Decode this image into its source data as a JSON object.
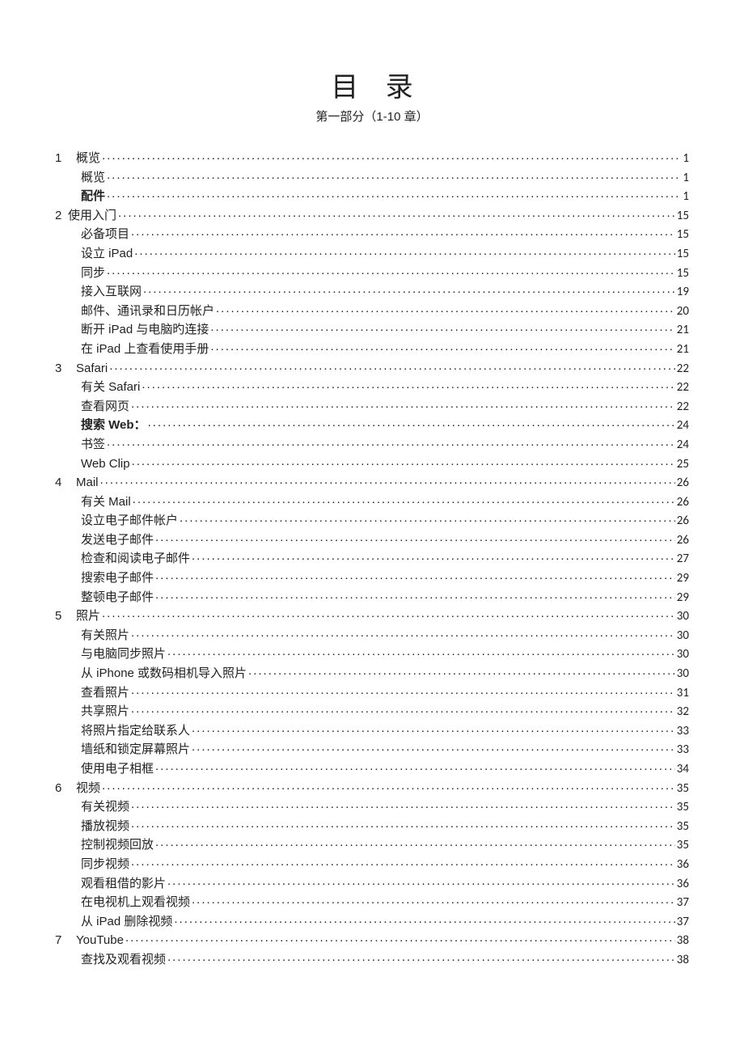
{
  "title": "目 录",
  "subtitle": "第一部分（1-10 章）",
  "toc": [
    {
      "num": "1",
      "indent": 0,
      "label": "概览",
      "page": "1"
    },
    {
      "num": "",
      "indent": 1,
      "label": "概览",
      "page": "1"
    },
    {
      "num": "",
      "indent": 1,
      "label": "配件",
      "page": "1",
      "bold": true
    },
    {
      "num": "2",
      "indent": 0,
      "label": "使用入门",
      "page": "15",
      "tight": true
    },
    {
      "num": "",
      "indent": 1,
      "label": "必备项目",
      "page": "15"
    },
    {
      "num": "",
      "indent": 1,
      "label": "设立 iPad",
      "page": "15"
    },
    {
      "num": "",
      "indent": 1,
      "label": "同步",
      "page": "15"
    },
    {
      "num": "",
      "indent": 1,
      "label": "接入互联网",
      "page": "19"
    },
    {
      "num": "",
      "indent": 1,
      "label": "邮件、通讯录和日历帐户",
      "page": "20"
    },
    {
      "num": "",
      "indent": 1,
      "label": "断开 iPad 与电脑旳连接",
      "page": "21"
    },
    {
      "num": "",
      "indent": 1,
      "label": "在 iPad 上查看使用手册",
      "page": "21"
    },
    {
      "num": "3",
      "indent": 0,
      "label": "Safari",
      "page": "22"
    },
    {
      "num": "",
      "indent": 1,
      "label": "有关 Safari",
      "page": "22"
    },
    {
      "num": "",
      "indent": 1,
      "label": "查看网页",
      "page": "22"
    },
    {
      "num": "",
      "indent": 1,
      "label": "搜索 Web：",
      "page": "24",
      "bold": true
    },
    {
      "num": "",
      "indent": 1,
      "label": "书签",
      "page": "24"
    },
    {
      "num": "",
      "indent": 1,
      "label": "Web Clip",
      "page": "25"
    },
    {
      "num": "4",
      "indent": 0,
      "label": "Mail",
      "page": "26"
    },
    {
      "num": "",
      "indent": 1,
      "label": "有关 Mail",
      "page": "26"
    },
    {
      "num": "",
      "indent": 1,
      "label": "设立电子邮件帐户",
      "page": "26"
    },
    {
      "num": "",
      "indent": 1,
      "label": "发送电子邮件",
      "page": "26"
    },
    {
      "num": "",
      "indent": 1,
      "label": "检查和阅读电子邮件",
      "page": "27"
    },
    {
      "num": "",
      "indent": 1,
      "label": "搜索电子邮件",
      "page": "29"
    },
    {
      "num": "",
      "indent": 1,
      "label": "整顿电子邮件",
      "page": "29"
    },
    {
      "num": "5",
      "indent": 0,
      "label": "照片",
      "page": "30"
    },
    {
      "num": "",
      "indent": 1,
      "label": "有关照片",
      "page": "30"
    },
    {
      "num": "",
      "indent": 1,
      "label": "与电脑同步照片",
      "page": "30"
    },
    {
      "num": "",
      "indent": 1,
      "label": "从 iPhone 或数码相机导入照片",
      "page": "30"
    },
    {
      "num": "",
      "indent": 1,
      "label": "查看照片",
      "page": "31"
    },
    {
      "num": "",
      "indent": 1,
      "label": "共享照片",
      "page": "32"
    },
    {
      "num": "",
      "indent": 1,
      "label": "将照片指定给联系人",
      "page": "33"
    },
    {
      "num": "",
      "indent": 1,
      "label": "墙纸和锁定屏幕照片",
      "page": "33"
    },
    {
      "num": "",
      "indent": 1,
      "label": "使用电子相框",
      "page": "34"
    },
    {
      "num": "6",
      "indent": 0,
      "label": "视频",
      "page": "35"
    },
    {
      "num": "",
      "indent": 1,
      "label": "有关视频",
      "page": "35"
    },
    {
      "num": "",
      "indent": 1,
      "label": "播放视频",
      "page": "35"
    },
    {
      "num": "",
      "indent": 1,
      "label": "控制视频回放",
      "page": "35"
    },
    {
      "num": "",
      "indent": 1,
      "label": "同步视频",
      "page": "36"
    },
    {
      "num": "",
      "indent": 1,
      "label": "观看租借的影片",
      "page": "36"
    },
    {
      "num": "",
      "indent": 1,
      "label": "在电视机上观看视频",
      "page": "37"
    },
    {
      "num": "",
      "indent": 1,
      "label": "从 iPad 删除视频",
      "page": "37"
    },
    {
      "num": "7",
      "indent": 0,
      "label": "YouTube",
      "page": "38"
    },
    {
      "num": "",
      "indent": 1,
      "label": "查找及观看视频",
      "page": "38"
    }
  ]
}
